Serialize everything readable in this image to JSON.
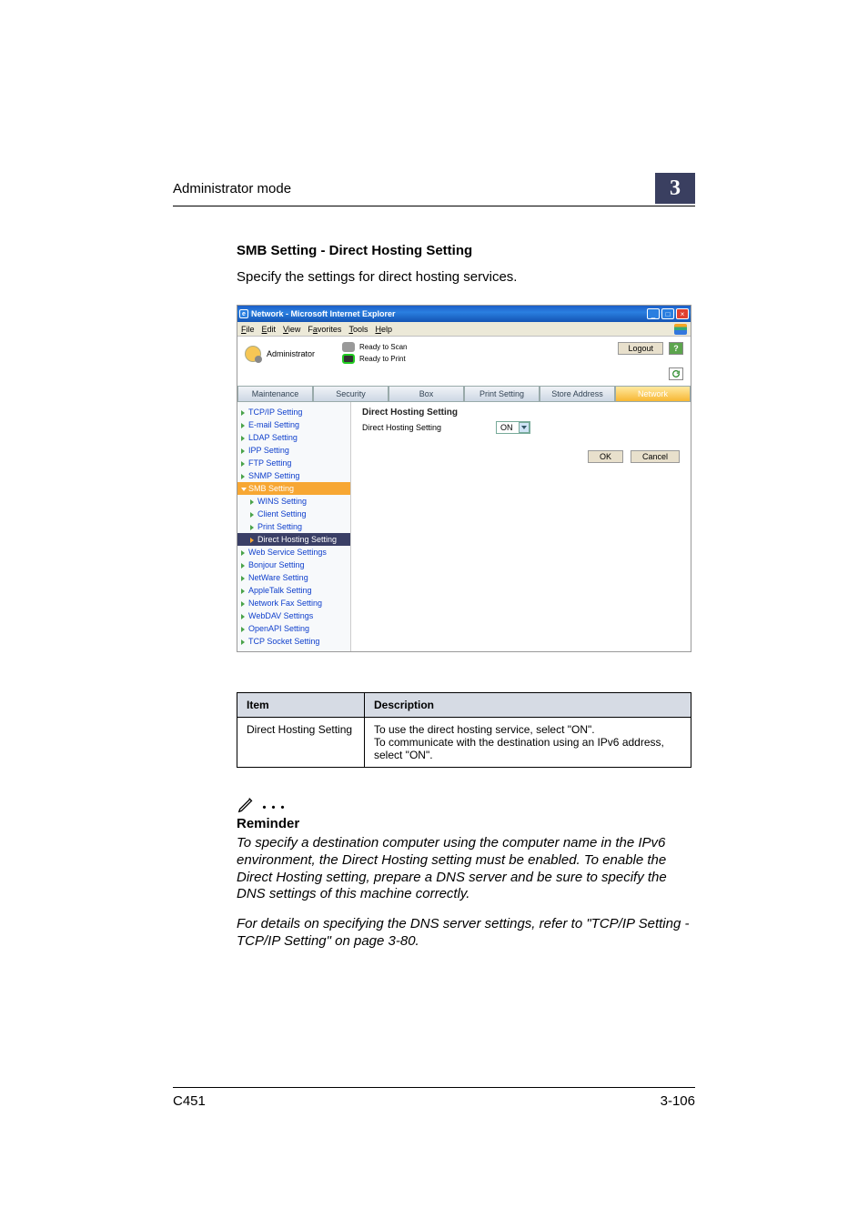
{
  "running_head": {
    "left": "Administrator mode",
    "chapter": "3"
  },
  "section": {
    "heading": "SMB Setting - Direct Hosting Setting",
    "intro": "Specify the settings for direct hosting services."
  },
  "ie": {
    "title": "Network - Microsoft Internet Explorer",
    "menus": {
      "file": "File",
      "edit": "Edit",
      "view": "View",
      "favorites": "Favorites",
      "tools": "Tools",
      "help": "Help"
    }
  },
  "app": {
    "role": "Administrator",
    "status_scan": "Ready to Scan",
    "status_print": "Ready to Print",
    "logout": "Logout",
    "help": "?"
  },
  "tabs": {
    "maintenance": "Maintenance",
    "security": "Security",
    "box": "Box",
    "print_setting": "Print Setting",
    "store_address": "Store Address",
    "network": "Network"
  },
  "nav": {
    "tcpip": "TCP/IP Setting",
    "email": "E-mail Setting",
    "ldap": "LDAP Setting",
    "ipp": "IPP Setting",
    "ftp": "FTP Setting",
    "snmp": "SNMP Setting",
    "smb": "SMB Setting",
    "wins": "WINS Setting",
    "client": "Client Setting",
    "print": "Print Setting",
    "direct_hosting": "Direct Hosting Setting",
    "web_service": "Web Service Settings",
    "bonjour": "Bonjour Setting",
    "netware": "NetWare Setting",
    "appletalk": "AppleTalk Setting",
    "netfax": "Network Fax Setting",
    "webdav": "WebDAV Settings",
    "openapi": "OpenAPI Setting",
    "tcpsocket": "TCP Socket Setting"
  },
  "content": {
    "heading": "Direct Hosting Setting",
    "field_label": "Direct Hosting Setting",
    "field_value": "ON",
    "ok": "OK",
    "cancel": "Cancel"
  },
  "table": {
    "col_item": "Item",
    "col_desc": "Description",
    "row1_item": "Direct Hosting Setting",
    "row1_desc": "To use the direct hosting service, select \"ON\".\nTo communicate with the destination using an IPv6 address, select \"ON\"."
  },
  "note": {
    "dots": ". . .",
    "title": "Reminder",
    "para1": "To specify a destination computer using the computer name in the IPv6 environment, the Direct Hosting setting must be enabled. To enable the Direct Hosting setting, prepare a DNS server and be sure to specify the DNS settings of this machine correctly.",
    "para2": "For details on specifying the DNS server settings, refer to \"TCP/IP Setting - TCP/IP Setting\" on page 3-80."
  },
  "footer": {
    "left": "C451",
    "right": "3-106"
  }
}
